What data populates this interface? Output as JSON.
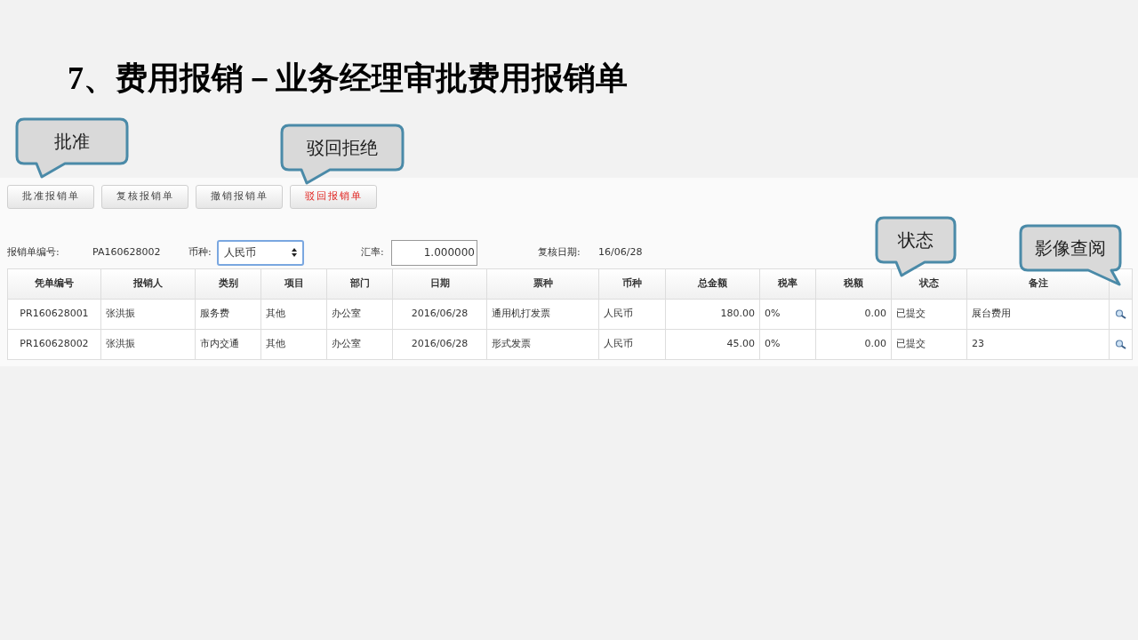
{
  "slide_title": "7、费用报销－业务经理审批费用报销单",
  "toolbar": [
    {
      "label": "批准报销单",
      "kind": "normal"
    },
    {
      "label": "复核报销单",
      "kind": "normal"
    },
    {
      "label": "撤销报销单",
      "kind": "normal"
    },
    {
      "label": "驳回报销单",
      "kind": "danger"
    }
  ],
  "form": {
    "number_label": "报销单编号:",
    "number_value": "PA160628002",
    "currency_label": "币种:",
    "currency_value": "人民币",
    "rate_label": "汇率:",
    "rate_value": "1.000000",
    "review_date_label": "复核日期:",
    "review_date_value": "16/06/28"
  },
  "table": {
    "columns": [
      "凭单编号",
      "报销人",
      "类别",
      "项目",
      "部门",
      "日期",
      "票种",
      "币种",
      "总金额",
      "税率",
      "税额",
      "状态",
      "备注"
    ],
    "rows": [
      {
        "cells": [
          "PR160628001",
          "张洪振",
          "服务费",
          "其他",
          "办公室",
          "2016/06/28",
          "通用机打发票",
          "人民币",
          "180.00",
          "0%",
          "0.00",
          "已提交",
          "展台费用"
        ]
      },
      {
        "cells": [
          "PR160628002",
          "张洪振",
          "市内交通",
          "其他",
          "办公室",
          "2016/06/28",
          "形式发票",
          "人民币",
          "45.00",
          "0%",
          "0.00",
          "已提交",
          "23"
        ]
      }
    ]
  },
  "callouts": [
    {
      "text": "批准",
      "kind": "left"
    },
    {
      "text": "驳回拒绝",
      "kind": "left"
    },
    {
      "text": "状态",
      "kind": "left"
    },
    {
      "text": "影像查阅",
      "kind": "right"
    }
  ]
}
